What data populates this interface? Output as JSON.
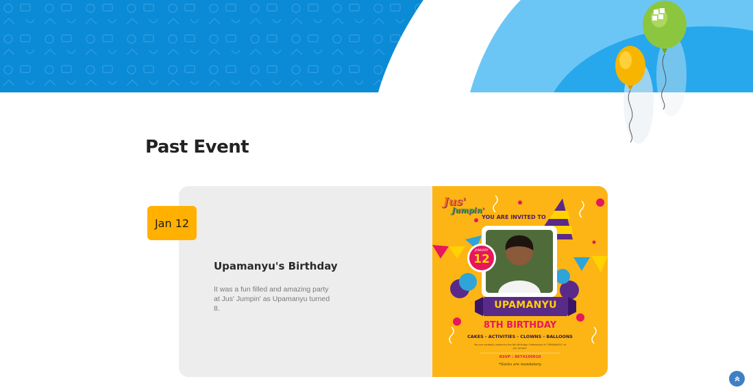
{
  "section": {
    "title": "Past Event"
  },
  "event": {
    "date": "Jan 12",
    "title": "Upamanyu's Birthday",
    "description": "It was a fun filled and amazing party at Jus' Jumpin' as Upamanyu turned 8."
  },
  "poster": {
    "logo_top": "Jus'",
    "logo_bottom": "Jumpin'",
    "invited": "YOU ARE INVITED TO",
    "month": "JANUARY",
    "day": "12",
    "name": "UPAMANYU",
    "birthday": "8TH BIRTHDAY",
    "activities": "CAKES - ACTIVITIES - CLOWNS - BALLOONS",
    "small_text": "You are cordially invited to the 8th Birthday Celebration of \"UPAMANYU\" at Jus' Jumpin'",
    "rsvp": "RSVP : 9674100010",
    "socks": "*Socks are mandatory"
  },
  "colors": {
    "banner_blue": "#0b8ad6",
    "banner_light": "#6cc6f5",
    "date_badge": "#ffb000",
    "card_bg": "#ededed",
    "poster_bg": "#fdb515",
    "scroll_top": "#3f7fc4"
  },
  "icons": {
    "scroll_top": "chevron-double-up-icon",
    "balloon_green": "balloon-icon",
    "balloon_yellow": "balloon-icon"
  }
}
